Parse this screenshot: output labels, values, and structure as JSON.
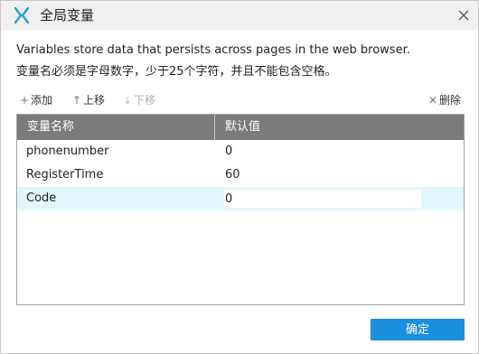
{
  "window": {
    "title": "全局变量",
    "app_icon": "axure-logo-icon",
    "close_icon": "close-icon"
  },
  "description": {
    "line1": "Variables store data that persists across pages in the web browser.",
    "line2": "变量名必须是字母数字，少于25个字符，并且不能包含空格。"
  },
  "toolbar": {
    "add": {
      "glyph": "+",
      "label": "添加",
      "enabled": true,
      "icon": "plus-icon"
    },
    "move_up": {
      "glyph": "↑",
      "label": "上移",
      "enabled": true,
      "icon": "arrow-up-icon"
    },
    "move_down": {
      "glyph": "↓",
      "label": "下移",
      "enabled": false,
      "icon": "arrow-down-icon"
    },
    "delete": {
      "glyph": "✕",
      "label": "删除",
      "enabled": true,
      "icon": "x-icon"
    }
  },
  "table": {
    "columns": [
      "变量名称",
      "默认值"
    ],
    "rows": [
      {
        "name": "phonenumber",
        "value": "0"
      },
      {
        "name": "RegisterTime",
        "value": "60"
      },
      {
        "name": "Code",
        "value": "0",
        "selected": true,
        "editing": true
      }
    ]
  },
  "footer": {
    "ok_label": "确定"
  },
  "colors": {
    "accent": "#1a8fdd",
    "header_bg": "#7b7b7b",
    "selected_row": "#e1f6fa",
    "titlebar_bg": "#f0f0f0"
  }
}
